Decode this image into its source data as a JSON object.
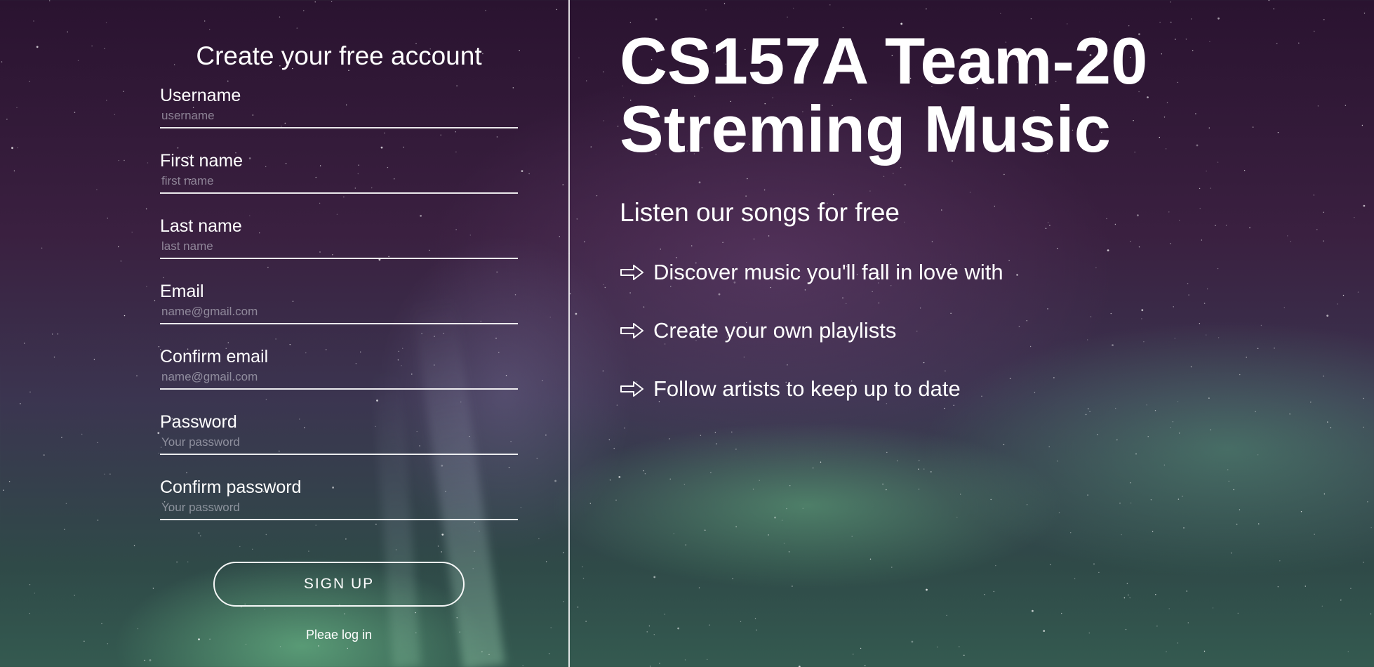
{
  "signup_form": {
    "title": "Create your free account",
    "fields": [
      {
        "label": "Username",
        "placeholder": "username",
        "value": ""
      },
      {
        "label": "First name",
        "placeholder": "first name",
        "value": ""
      },
      {
        "label": "Last name",
        "placeholder": "last name",
        "value": ""
      },
      {
        "label": "Email",
        "placeholder": "name@gmail.com",
        "value": ""
      },
      {
        "label": "Confirm email",
        "placeholder": "name@gmail.com",
        "value": ""
      },
      {
        "label": "Password",
        "placeholder": "Your password",
        "value": ""
      },
      {
        "label": "Confirm password",
        "placeholder": "Your password",
        "value": ""
      }
    ],
    "submit_label": "SIGN UP",
    "login_link": "Pleae log in"
  },
  "hero": {
    "title_line1": "CS157A Team-20",
    "title_line2": "Streming Music",
    "subtitle": "Listen our songs for free",
    "features": [
      {
        "icon": "arrow-right-icon",
        "text": "Discover music you'll fall in love with"
      },
      {
        "icon": "arrow-right-icon",
        "text": "Create your own playlists"
      },
      {
        "icon": "arrow-right-icon",
        "text": "Follow artists to keep up to date"
      }
    ]
  },
  "colors": {
    "text": "#ffffff",
    "placeholder": "#9a9aa8",
    "background_top": "#2a1330",
    "aurora_green": "#6ec88c"
  }
}
